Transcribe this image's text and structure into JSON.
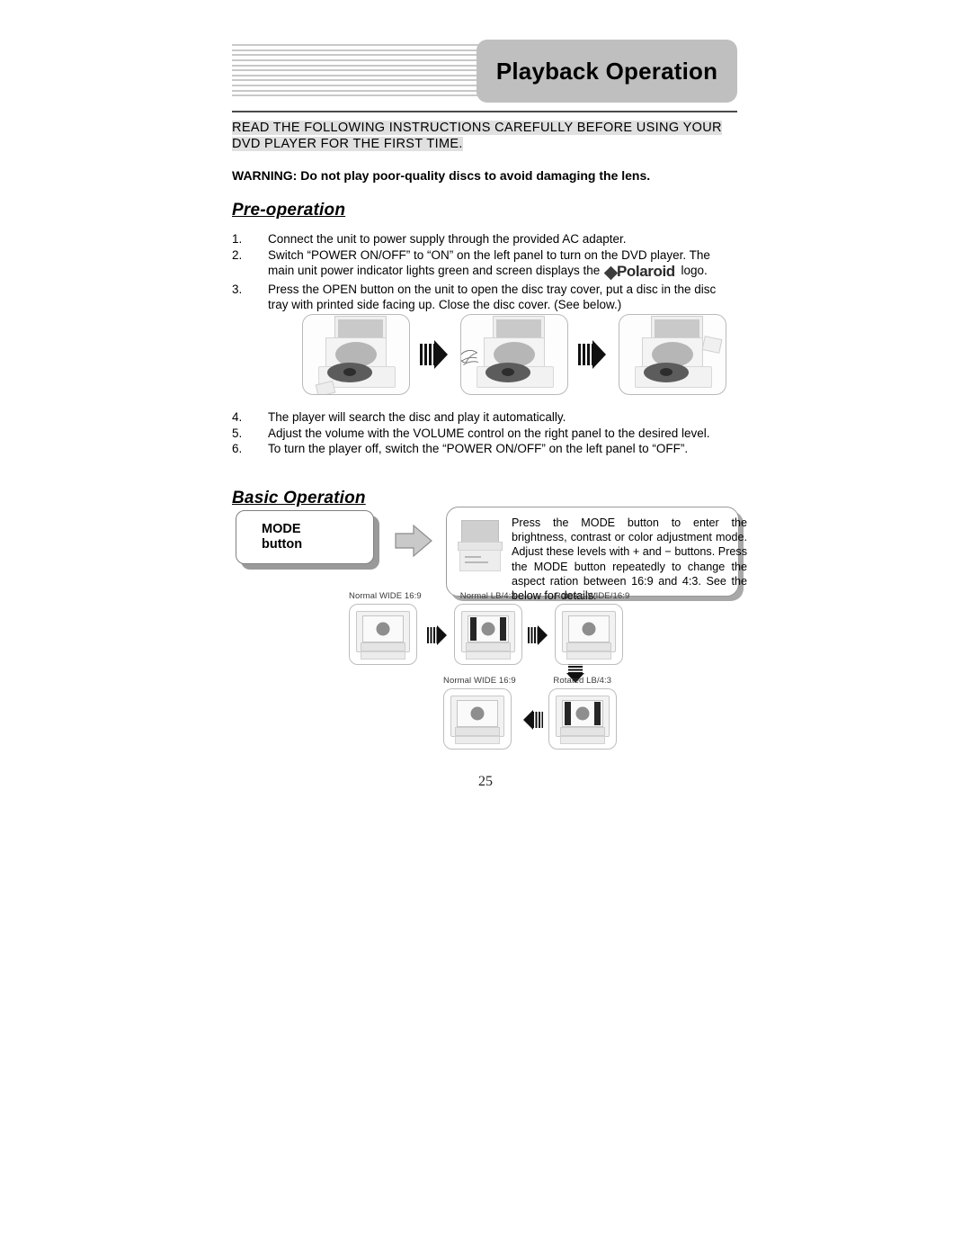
{
  "header": {
    "title": "Playback Operation",
    "stripe_count": 11
  },
  "lead_paragraph": "READ THE FOLLOWING INSTRUCTIONS CAREFULLY BEFORE USING YOUR DVD PLAYER FOR THE FIRST TIME.",
  "warning": "WARNING: Do not play poor-quality discs to avoid damaging the lens.",
  "sections": {
    "pre_operation": {
      "title": "Pre-operation",
      "steps_before_figure": [
        {
          "num": "1.",
          "text": "Connect the unit to power supply through the provided AC adapter."
        },
        {
          "num": "2.",
          "text_a": "Switch “POWER ON/OFF” to “ON” on the left panel to turn on the DVD player. The main unit power indicator lights green and screen displays the ",
          "logo": "Polaroid",
          "text_b": " logo."
        },
        {
          "num": "3.",
          "text": "Press the OPEN button on the unit to open the disc tray cover, put a disc in the disc tray with printed side facing up. Close the disc cover. (See below.)"
        }
      ],
      "steps_after_figure": [
        {
          "num": "4.",
          "text": "The player will search the disc and play it automatically."
        },
        {
          "num": "5.",
          "text": "Adjust the volume with the VOLUME control on the right panel to the desired level."
        },
        {
          "num": "6.",
          "text": "To turn the player off, switch the “POWER ON/OFF” on the left panel to “OFF”."
        }
      ]
    },
    "basic_operation": {
      "title": "Basic Operation",
      "mode_button": {
        "line1": "MODE",
        "line2": "button"
      },
      "callout_text": "Press the MODE button to enter the brightness, contrast or color adjustment mode. Adjust these levels with + and − buttons. Press the MODE button repeatedly to change the aspect ration between 16:9 and 4:3. See the below for details:"
    }
  },
  "disc_flow": {
    "steps": [
      {
        "label": "open-tray"
      },
      {
        "label": "insert-disc"
      },
      {
        "label": "close-cover"
      }
    ]
  },
  "aspect_diagrams": {
    "row1": [
      {
        "label": "Normal WIDE 16:9",
        "letterbox": false
      },
      {
        "label": "Normal LB/4:3",
        "letterbox": true
      },
      {
        "label": "Rotated WIDE/16:9",
        "letterbox": false
      }
    ],
    "row2": [
      {
        "label": "Normal WIDE 16:9",
        "letterbox": false
      },
      {
        "label": "Rotated LB/4:3",
        "letterbox": true
      }
    ]
  },
  "page_number": "25",
  "colors": {
    "title_box": "#bfbfbf",
    "stripe": "#c8c8c8",
    "highlight": "#e0e0e0",
    "rule": "#4a4a4a"
  }
}
